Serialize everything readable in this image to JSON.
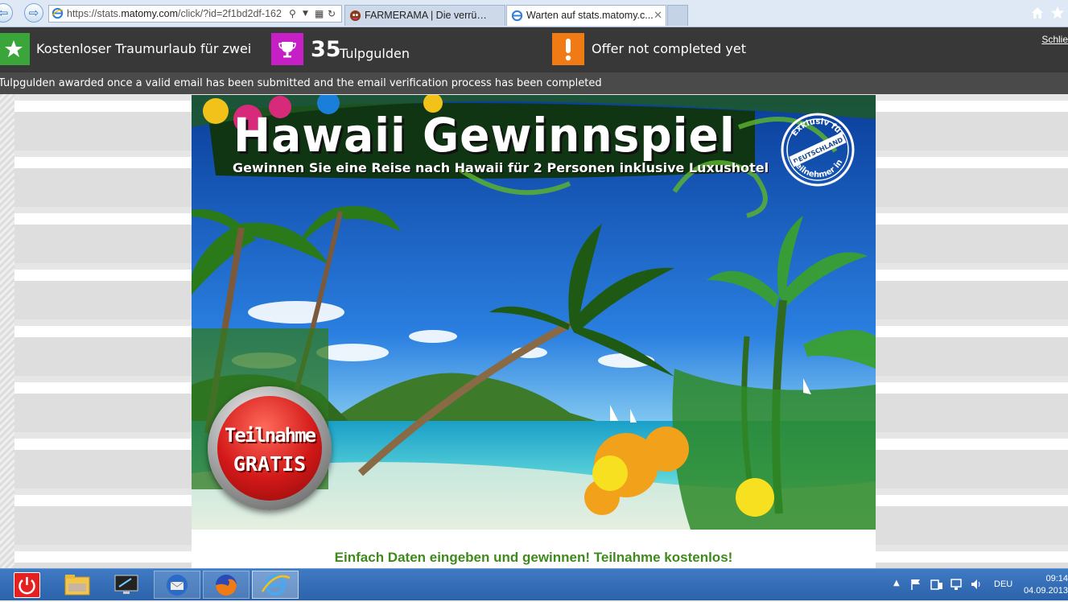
{
  "browser": {
    "url_prefix": "https://stats.",
    "url_domain": "matomy.com",
    "url_rest": "/click/?id=2f1bd2df-162",
    "tabs": [
      {
        "label": "FARMERAMA | Die verrücktest..."
      },
      {
        "label": "Warten auf stats.matomy.c..."
      }
    ]
  },
  "offer": {
    "title": "Kostenloser Traumurlaub für zwei",
    "points": "35",
    "points_unit": "Tulpgulden",
    "status": "Offer not completed yet",
    "close_label": "Schlie",
    "info": "Tulpgulden awarded once a valid email has been submitted and the email verification process has been completed"
  },
  "banner": {
    "title": "Hawaii  Gewinnspiel",
    "subtitle": "Gewinnen Sie eine Reise nach Hawaii für 2 Personen inklusive Luxushotel",
    "cta_line1": "Teilnahme",
    "cta_line2": "GRATIS",
    "stamp_top": "Exklusiv für",
    "stamp_mid": "DEUTSCHLAND",
    "stamp_bottom": "Teilnehmer in"
  },
  "page": {
    "tagline": "Einfach Daten eingeben und gewinnen! Teilnahme kostenlos!"
  },
  "taskbar": {
    "language": "DEU",
    "time": "09:14",
    "date": "04.09.2013"
  },
  "colors": {
    "offer_bar": "#383838",
    "green": "#3aa63a",
    "pink": "#c51fc5",
    "orange": "#f07a14",
    "tagline": "#3f8a1c"
  }
}
